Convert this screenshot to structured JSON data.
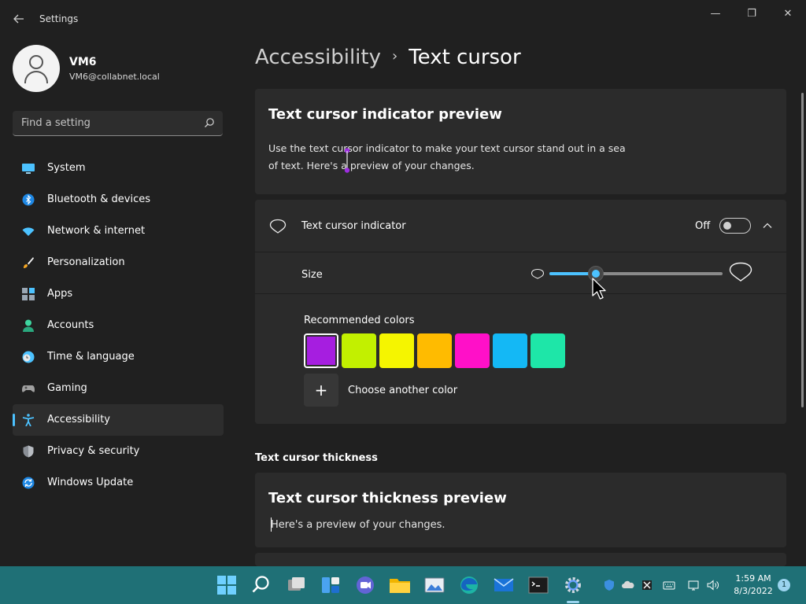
{
  "window": {
    "title": "Settings",
    "back_icon": "back-arrow-icon",
    "minimize_glyph": "—",
    "maximize_glyph": "❐",
    "close_glyph": "✕"
  },
  "profile": {
    "name": "VM6",
    "email": "VM6@collabnet.local"
  },
  "search": {
    "placeholder": "Find a setting",
    "icon": "search-icon"
  },
  "nav": {
    "items": [
      {
        "label": "System",
        "icon": "system-icon",
        "selected": false
      },
      {
        "label": "Bluetooth & devices",
        "icon": "bluetooth-icon",
        "selected": false
      },
      {
        "label": "Network & internet",
        "icon": "wifi-icon",
        "selected": false
      },
      {
        "label": "Personalization",
        "icon": "paintbrush-icon",
        "selected": false
      },
      {
        "label": "Apps",
        "icon": "apps-icon",
        "selected": false
      },
      {
        "label": "Accounts",
        "icon": "person-icon",
        "selected": false
      },
      {
        "label": "Time & language",
        "icon": "clock-globe-icon",
        "selected": false
      },
      {
        "label": "Gaming",
        "icon": "gamepad-icon",
        "selected": false
      },
      {
        "label": "Accessibility",
        "icon": "accessibility-icon",
        "selected": true
      },
      {
        "label": "Privacy & security",
        "icon": "shield-icon",
        "selected": false
      },
      {
        "label": "Windows Update",
        "icon": "update-icon",
        "selected": false
      }
    ]
  },
  "breadcrumb": {
    "parent": "Accessibility",
    "separator": "›",
    "current": "Text cursor"
  },
  "preview": {
    "title": "Text cursor indicator preview",
    "description_line1": "Use the text cursor indicator to make your text cursor stand out in a sea",
    "description_line2": "of text. Here's a preview of your changes.",
    "indicator_color": "#9d2ee0"
  },
  "indicator": {
    "label": "Text cursor indicator",
    "state_label": "Off",
    "enabled": false,
    "expanded": true
  },
  "size": {
    "label": "Size",
    "level": 0.27
  },
  "colors": {
    "label": "Recommended colors",
    "swatches": [
      {
        "color": "#a61ee0",
        "selected": true
      },
      {
        "color": "#c2f000",
        "selected": false
      },
      {
        "color": "#f5f500",
        "selected": false
      },
      {
        "color": "#ffbb00",
        "selected": false
      },
      {
        "color": "#ff10c8",
        "selected": false
      },
      {
        "color": "#14b8f5",
        "selected": false
      },
      {
        "color": "#1ee6a8",
        "selected": false
      }
    ],
    "add_glyph": "+",
    "add_label": "Choose another color"
  },
  "thickness": {
    "section_heading": "Text cursor thickness",
    "preview_title": "Text cursor thickness preview",
    "preview_text": "Here's a preview of your changes."
  },
  "taskbar": {
    "active_app": "settings",
    "time": "1:59 AM",
    "date": "8/3/2022",
    "notification_count": "1",
    "accent": "#1f7076"
  }
}
